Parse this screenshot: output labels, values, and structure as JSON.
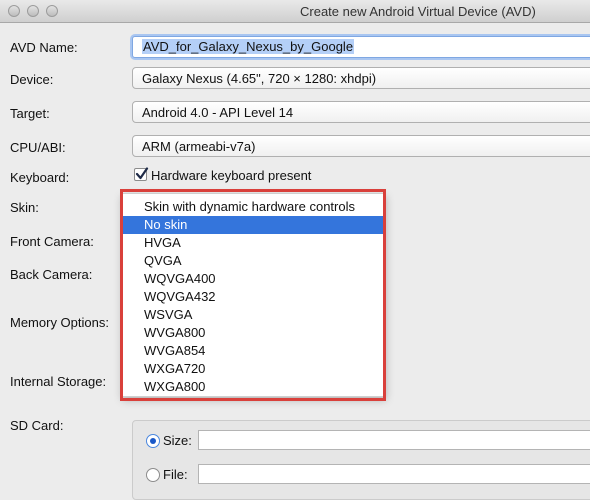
{
  "window": {
    "title": "Create new Android Virtual Device (AVD)"
  },
  "form": {
    "avd_name_label": "AVD Name:",
    "avd_name_value": "AVD_for_Galaxy_Nexus_by_Google",
    "device_label": "Device:",
    "device_value": "Galaxy Nexus (4.65\", 720 × 1280: xhdpi)",
    "target_label": "Target:",
    "target_value": "Android 4.0 - API Level 14",
    "cpu_label": "CPU/ABI:",
    "cpu_value": "ARM (armeabi-v7a)",
    "keyboard_label": "Keyboard:",
    "keyboard_checkbox_label": "Hardware keyboard present",
    "keyboard_checked": true,
    "skin_label": "Skin:",
    "front_camera_label": "Front Camera:",
    "back_camera_label": "Back Camera:",
    "memory_label": "Memory Options:",
    "internal_storage_label": "Internal Storage:",
    "sd_card_label": "SD Card:",
    "sd_size_label": "Size:",
    "sd_file_label": "File:",
    "sd_selected": "Size"
  },
  "skin_dropdown": {
    "selected": "No skin",
    "options": [
      "Skin with dynamic hardware controls",
      "No skin",
      "HVGA",
      "QVGA",
      "WQVGA400",
      "WQVGA432",
      "WSVGA",
      "WVGA800",
      "WVGA854",
      "WXGA720",
      "WXGA800"
    ]
  },
  "colors": {
    "selection": "#3475dc",
    "highlight_border": "#d9403b",
    "text_selection": "#b4cff7"
  }
}
